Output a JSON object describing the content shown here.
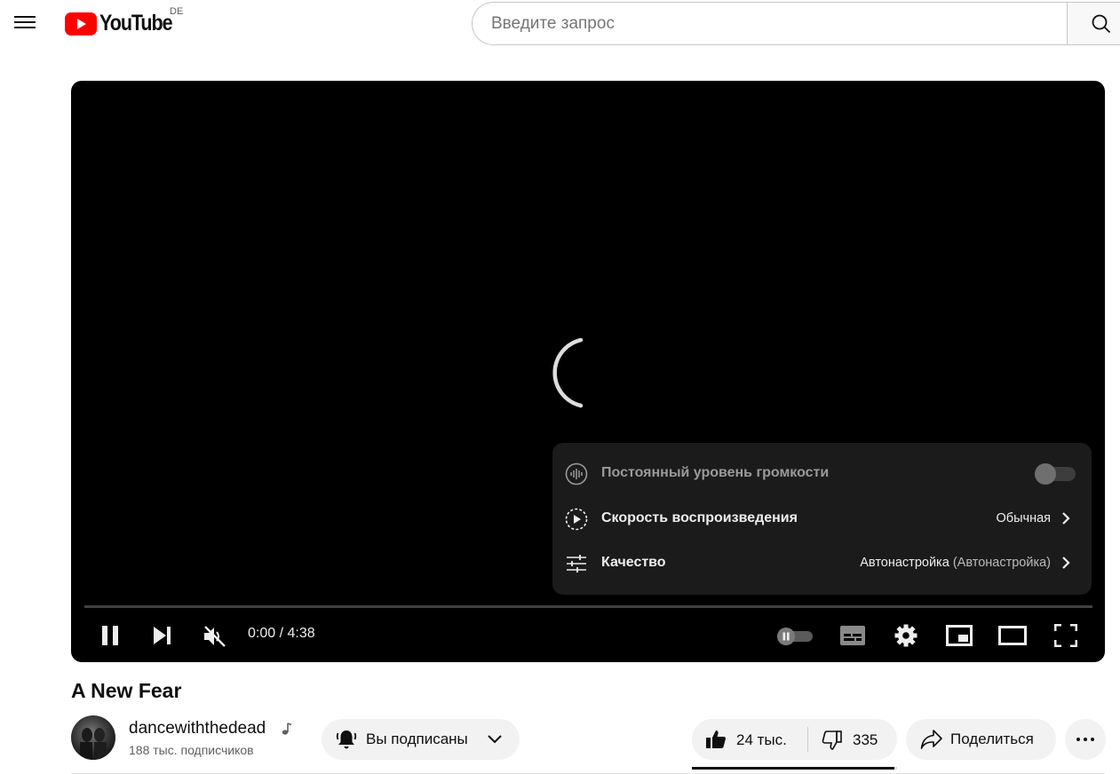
{
  "header": {
    "logo_text": "YouTube",
    "country_code": "DE",
    "search_placeholder": "Введите запрос",
    "brand_color": "#ff0000"
  },
  "player": {
    "state": "loading",
    "time_current": "0:00",
    "time_separator": " / ",
    "time_total": "4:38",
    "progress_fraction": 0.0,
    "settings_menu": {
      "items": [
        {
          "icon": "stable-volume-icon",
          "label": "Постоянный уровень громкости",
          "value": "",
          "value_sub": "",
          "toggle": false,
          "disabled": true
        },
        {
          "icon": "playback-speed-icon",
          "label": "Скорость воспроизведения",
          "value": "Обычная",
          "value_sub": ""
        },
        {
          "icon": "quality-icon",
          "label": "Качество",
          "value": "Автонастройка",
          "value_sub": " (Автонастройка)"
        }
      ]
    },
    "controls": [
      "pause-icon",
      "next-icon",
      "mute-icon",
      "autoplay-toggle-icon",
      "subtitles-icon",
      "settings-icon",
      "miniplayer-icon",
      "theater-mode-icon",
      "fullscreen-icon"
    ]
  },
  "video": {
    "title": "A New Fear",
    "channel_name": "dancewiththedead",
    "channel_badge_icon": "music-note-icon",
    "subscribers": "188 тыс. подписчиков",
    "subscribe_label": "Вы подписаны",
    "likes": "24 тыс.",
    "dislikes": "335",
    "like_ratio": 0.986,
    "share_label": "Поделиться"
  }
}
